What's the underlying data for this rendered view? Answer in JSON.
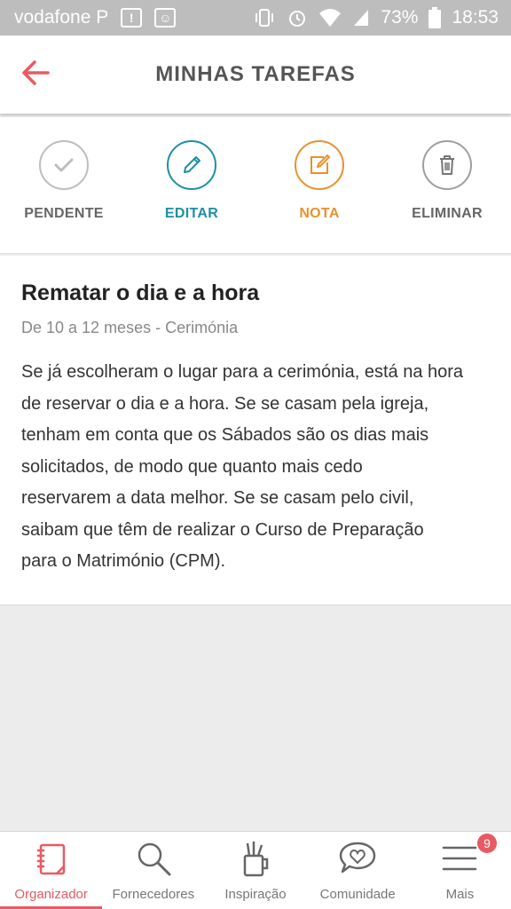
{
  "status_bar": {
    "carrier": "vodafone P",
    "battery": "73%",
    "time": "18:53"
  },
  "header": {
    "title": "MINHAS TAREFAS",
    "back_icon": "arrow-left-icon"
  },
  "actions": [
    {
      "label": "PENDENTE",
      "icon": "check-icon",
      "color": "#9e9e9e"
    },
    {
      "label": "EDITAR",
      "icon": "pencil-icon",
      "color": "#1f8fa4"
    },
    {
      "label": "NOTA",
      "icon": "note-icon",
      "color": "#e8922e"
    },
    {
      "label": "ELIMINAR",
      "icon": "trash-icon",
      "color": "#757575"
    }
  ],
  "task": {
    "title": "Rematar o dia e a hora",
    "subtitle": "De 10 a 12 meses - Cerimónia",
    "body_lines": [
      "Se já escolheram o lugar para a cerimónia, está na hora",
      "de reservar o dia e a hora. Se se casam pela igreja,",
      "tenham em conta que os Sábados são os dias mais",
      "solicitados, de modo que quanto mais cedo",
      "reservarem a data melhor. Se se casam pelo civil,",
      "saibam que têm de realizar o Curso de Preparação",
      "para o Matrimónio (CPM)."
    ]
  },
  "bottom_nav": [
    {
      "label": "Organizador",
      "icon": "planner-icon",
      "active": true
    },
    {
      "label": "Fornecedores",
      "icon": "search-icon",
      "active": false
    },
    {
      "label": "Inspiração",
      "icon": "pencil-cup-icon",
      "active": false
    },
    {
      "label": "Comunidade",
      "icon": "chat-heart-icon",
      "active": false
    },
    {
      "label": "Mais",
      "icon": "menu-icon",
      "active": false,
      "badge": "9"
    }
  ],
  "colors": {
    "accent": "#e85a61",
    "status_bar": "#bdbdbd"
  }
}
